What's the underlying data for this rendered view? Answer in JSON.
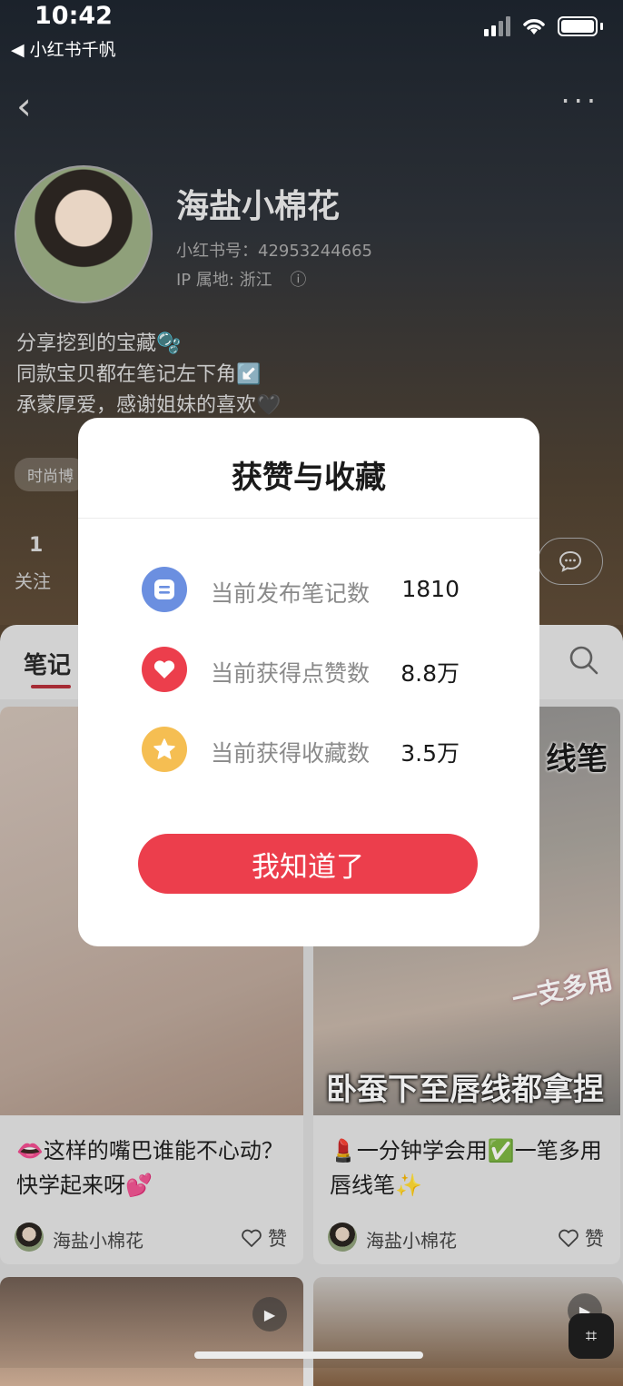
{
  "status_bar": {
    "time": "10:42",
    "back_app": "◀ 小红书千帆"
  },
  "profile": {
    "name": "海盐小棉花",
    "red_id": "小红书号：42953244665",
    "ip": "IP 属地: 浙江",
    "bio": [
      "分享挖到的宝藏🫧",
      "同款宝贝都在笔记左下角↙️",
      "承蒙厚爱，感谢姐妹的喜欢🖤"
    ],
    "tag": "时尚博",
    "follow_count": "1",
    "follow_label": "关注"
  },
  "tabs": {
    "notes": "笔记"
  },
  "feed": {
    "cards": [
      {
        "title": "👄这样的嘴巴谁能不心动？快学起来呀💕",
        "author": "海盐小棉花",
        "like_label": "赞"
      },
      {
        "title": "💄一分钟学会用✅一笔多用唇线笔✨",
        "author": "海盐小棉花",
        "like_label": "赞",
        "overlay_top": "线笔",
        "overlay_mid": "一支多用",
        "overlay_bottom": "卧蚕下至唇线都拿捏"
      }
    ]
  },
  "modal": {
    "title": "获赞与收藏",
    "stats": [
      {
        "label": "当前发布笔记数",
        "value": "1810",
        "icon": "note-icon",
        "color": "#6b8fe0"
      },
      {
        "label": "当前获得点赞数",
        "value": "8.8万",
        "icon": "heart-icon",
        "color": "#ec3e4c"
      },
      {
        "label": "当前获得收藏数",
        "value": "3.5万",
        "icon": "star-icon",
        "color": "#f5be52"
      }
    ],
    "confirm_label": "我知道了"
  }
}
